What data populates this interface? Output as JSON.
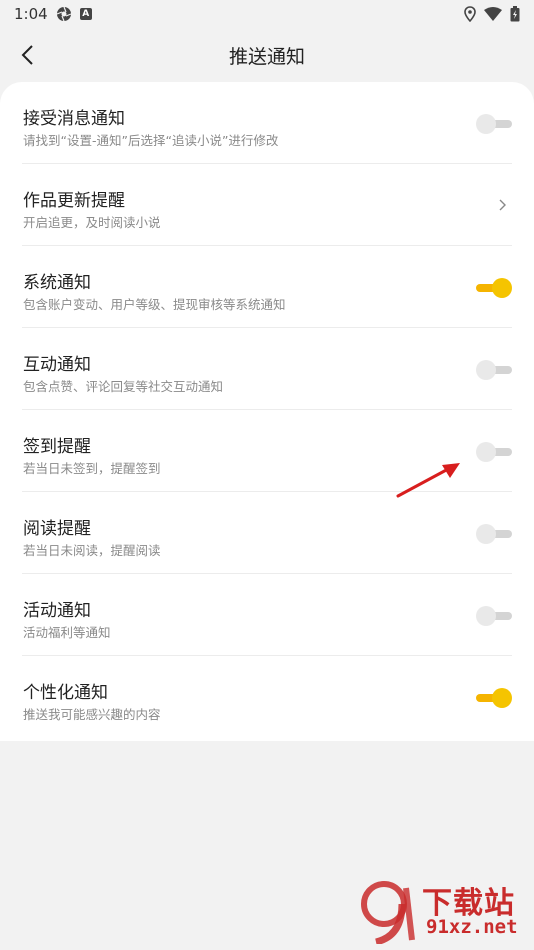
{
  "status_bar": {
    "time": "1:04",
    "app_badge": "A"
  },
  "header": {
    "title": "推送通知"
  },
  "settings": [
    {
      "title": "接受消息通知",
      "subtitle": "请找到“设置-通知”后选择“追读小说”进行修改",
      "control": "toggle",
      "on": false
    },
    {
      "title": "作品更新提醒",
      "subtitle": "开启追更，及时阅读小说",
      "control": "chevron",
      "on": null
    },
    {
      "title": "系统通知",
      "subtitle": "包含账户变动、用户等级、提现审核等系统通知",
      "control": "toggle",
      "on": true
    },
    {
      "title": "互动通知",
      "subtitle": "包含点赞、评论回复等社交互动通知",
      "control": "toggle",
      "on": false
    },
    {
      "title": "签到提醒",
      "subtitle": "若当日未签到，提醒签到",
      "control": "toggle",
      "on": false
    },
    {
      "title": "阅读提醒",
      "subtitle": "若当日未阅读，提醒阅读",
      "control": "toggle",
      "on": false
    },
    {
      "title": "活动通知",
      "subtitle": "活动福利等通知",
      "control": "toggle",
      "on": false
    },
    {
      "title": "个性化通知",
      "subtitle": "推送我可能感兴趣的内容",
      "control": "toggle",
      "on": true
    }
  ],
  "watermark": {
    "text": "下载站",
    "url": "91xz.net",
    "logo": "9"
  },
  "colors": {
    "accent": "#f5b400",
    "annotation_arrow": "#d81e1e",
    "watermark": "#c92c2c"
  }
}
